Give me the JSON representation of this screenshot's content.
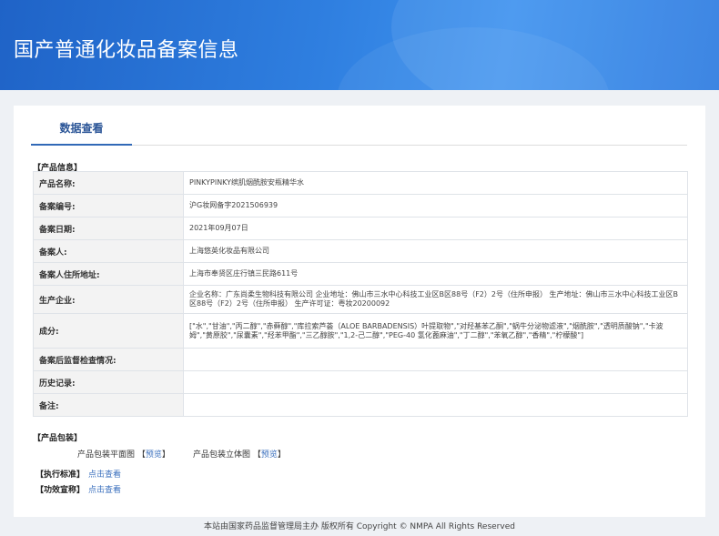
{
  "header": {
    "title": "国产普通化妆品备案信息"
  },
  "tabs": [
    {
      "label": "数据查看"
    }
  ],
  "product_info": {
    "section_label": "【产品信息】",
    "rows": [
      {
        "key": "产品名称:",
        "value": "PINKYPINKY缤肌烟酰胺安瓶精华水"
      },
      {
        "key": "备案编号:",
        "value": "沪G妆网备字2021506939"
      },
      {
        "key": "备案日期:",
        "value": "2021年09月07日"
      },
      {
        "key": "备案人:",
        "value": "上海悠英化妆品有限公司"
      },
      {
        "key": "备案人住所地址:",
        "value": "上海市奉贤区庄行镇三民路611号"
      },
      {
        "key": "生产企业:",
        "value": "企业名称：广东尚柔生物科技有限公司 企业地址：佛山市三水中心科技工业区B区88号（F2）2号（住所申报） 生产地址：佛山市三水中心科技工业区B区88号（F2）2号（住所申报） 生产许可证：粤妆20200092"
      },
      {
        "key": "成分:",
        "value": "[\"水\",\"甘油\",\"丙二醇\",\"赤藓醇\",\"库拉索芦荟（ALOE BARBADENSIS）叶提取物\",\"对羟基苯乙酮\",\"蜗牛分泌物滤液\",\"烟酰胺\",\"透明质酸钠\",\"卡波姆\",\"黄原胶\",\"尿囊素\",\"羟苯甲酯\",\"三乙醇胺\",\"1,2-己二醇\",\"PEG-40 氢化蓖麻油\",\"丁二醇\",\"苯氧乙醇\",\"香精\",\"柠檬酸\"]"
      },
      {
        "key": "备案后监督检查情况:",
        "value": ""
      },
      {
        "key": "历史记录:",
        "value": ""
      },
      {
        "key": "备注:",
        "value": ""
      }
    ]
  },
  "packaging": {
    "section_label": "【产品包装】",
    "items": [
      {
        "label": "产品包装平面图",
        "open": "【",
        "link": "预览",
        "close": "】"
      },
      {
        "label": "产品包装立体图",
        "open": "【",
        "link": "预览",
        "close": "】"
      }
    ]
  },
  "standards": {
    "label": "【执行标准】",
    "link": "点击查看"
  },
  "efficacy": {
    "label": "【功效宣称】",
    "link": "点击查看"
  },
  "footer": {
    "text": "本站由国家药品监督管理局主办 版权所有 Copyright © NMPA All Rights Reserved"
  }
}
